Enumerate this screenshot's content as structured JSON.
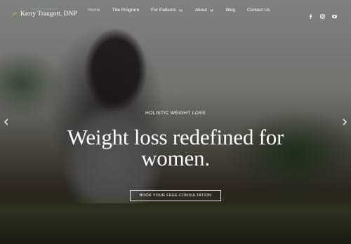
{
  "brand": {
    "name": "Kerry Traugott, DNP",
    "tagline": "Nurse Practitioner"
  },
  "nav": {
    "items": [
      "Home",
      "The Program",
      "For Patients",
      "About",
      "Blog",
      "Contact Us"
    ]
  },
  "social": {
    "icons": [
      "facebook-icon",
      "instagram-icon",
      "youtube-icon"
    ]
  },
  "hero": {
    "eyebrow": "HOLISTIC WEIGHT LOSS",
    "headline_line1": "Weight loss redefined for",
    "headline_line2": "women.",
    "cta_label": "BOOK YOUR FREE CONSULTATION"
  },
  "colors": {
    "text": "#ffffff",
    "tagline": "#6fb0d8",
    "logo_mark": "#8fb35a"
  }
}
